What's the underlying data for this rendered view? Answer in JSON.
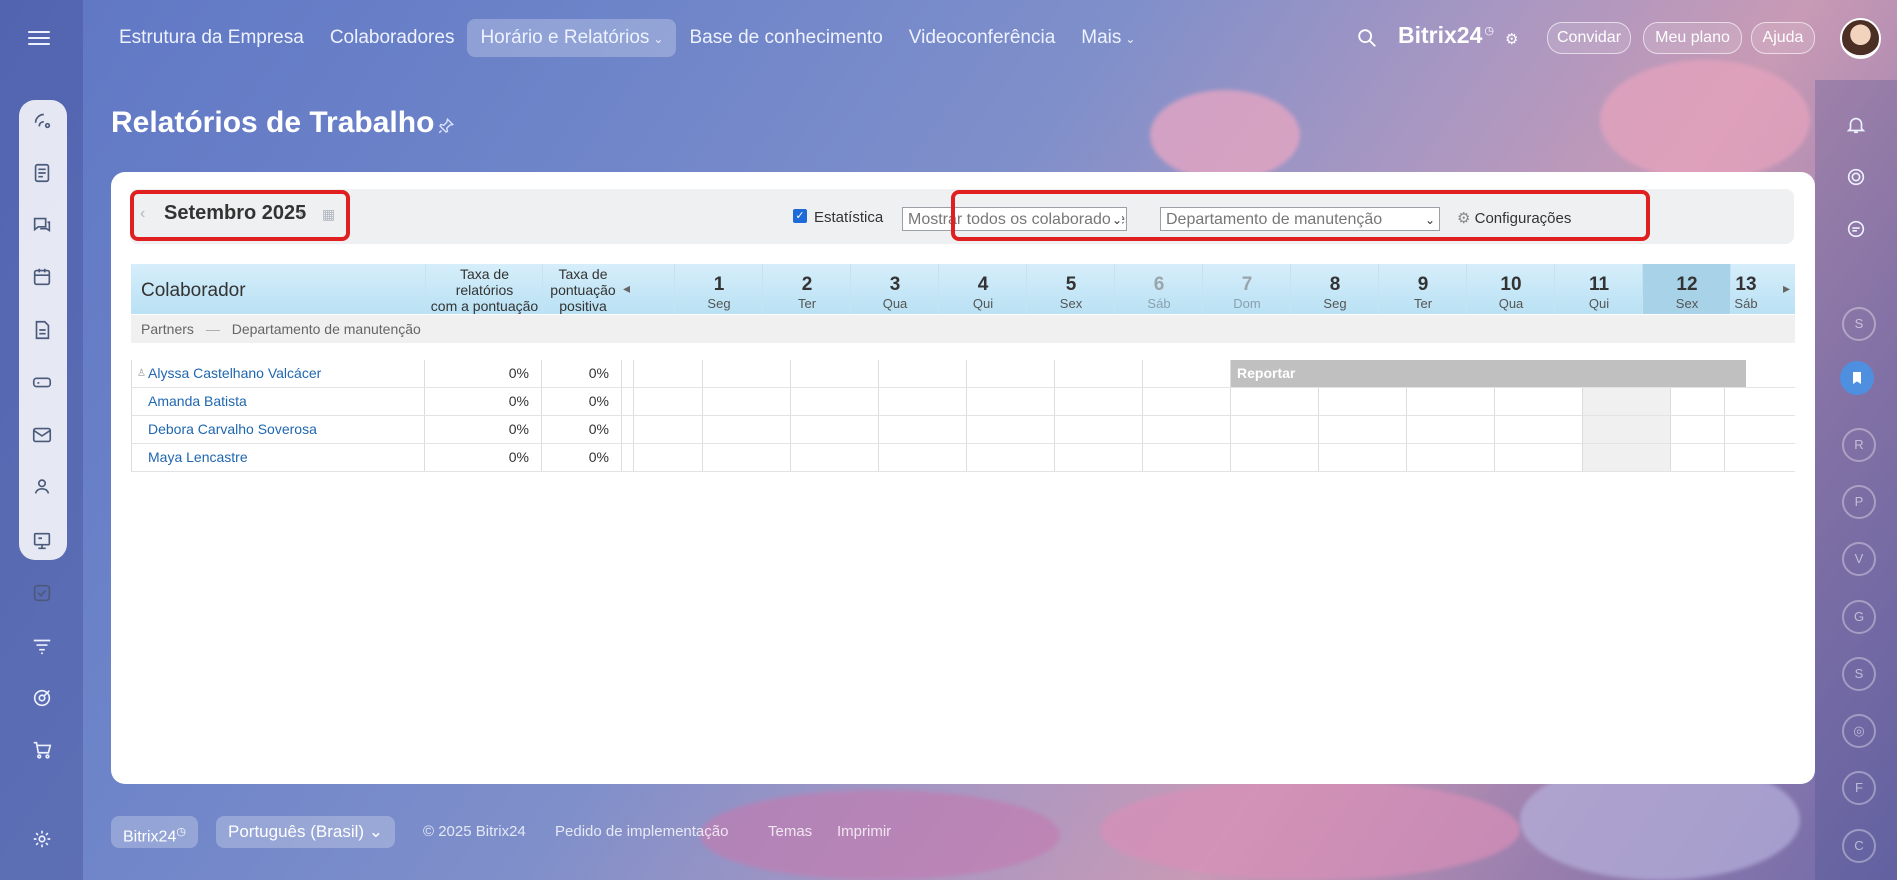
{
  "topnav": {
    "items": [
      "Estrutura da Empresa",
      "Colaboradores",
      "Horário e Relatórios",
      "Base de conhecimento",
      "Videoconferência",
      "Mais"
    ],
    "brand": "Bitrix24",
    "brand_mark": "◷",
    "invite": "Convidar",
    "plan": "Meu plano",
    "help": "Ajuda"
  },
  "page": {
    "title": "Relatórios de Trabalho"
  },
  "toolbar": {
    "month": "Setembro 2025",
    "statistics_label": "Estatística",
    "employees_select": "Mostrar todos os colaboradores",
    "department_select": "Departamento de manutenção",
    "settings": "Configurações"
  },
  "table": {
    "col_employee": "Colaborador",
    "col_rate_reports": [
      "Taxa de",
      "relatórios",
      "com a pontuação"
    ],
    "col_rate_positive": [
      "Taxa de",
      "pontuação",
      "positiva"
    ],
    "days": [
      {
        "n": "1",
        "w": "Seg"
      },
      {
        "n": "2",
        "w": "Ter"
      },
      {
        "n": "3",
        "w": "Qua"
      },
      {
        "n": "4",
        "w": "Qui"
      },
      {
        "n": "5",
        "w": "Sex"
      },
      {
        "n": "6",
        "w": "Sáb"
      },
      {
        "n": "7",
        "w": "Dom"
      },
      {
        "n": "8",
        "w": "Seg"
      },
      {
        "n": "9",
        "w": "Ter"
      },
      {
        "n": "10",
        "w": "Qua"
      },
      {
        "n": "11",
        "w": "Qui"
      },
      {
        "n": "12",
        "w": "Sex"
      },
      {
        "n": "13",
        "w": "Sáb"
      }
    ],
    "group": {
      "company": "Partners",
      "separator": "—",
      "department": "Departamento de manutenção"
    },
    "rows": [
      {
        "name": "Alyssa Castelhano Valcácer",
        "rate": "0%",
        "positive": "0%"
      },
      {
        "name": "Amanda Batista",
        "rate": "0%",
        "positive": "0%"
      },
      {
        "name": "Debora Carvalho Soverosa",
        "rate": "0%",
        "positive": "0%"
      },
      {
        "name": "Maya Lencastre",
        "rate": "0%",
        "positive": "0%"
      }
    ],
    "report_label": "Reportar"
  },
  "rightbar": {
    "letters": [
      "S",
      "R",
      "P",
      "V",
      "G",
      "S",
      "F",
      "C"
    ]
  },
  "footer": {
    "brand": "Bitrix24",
    "language": "Português (Brasil)",
    "copyright": "© 2025 Bitrix24",
    "link_impl": "Pedido de implementação",
    "link_themes": "Temas",
    "link_print": "Imprimir"
  },
  "colors": {
    "accent": "#1e6ad6",
    "link": "#2067b0",
    "highlight_box": "#e02020",
    "table_header": "#b9e1f4"
  }
}
